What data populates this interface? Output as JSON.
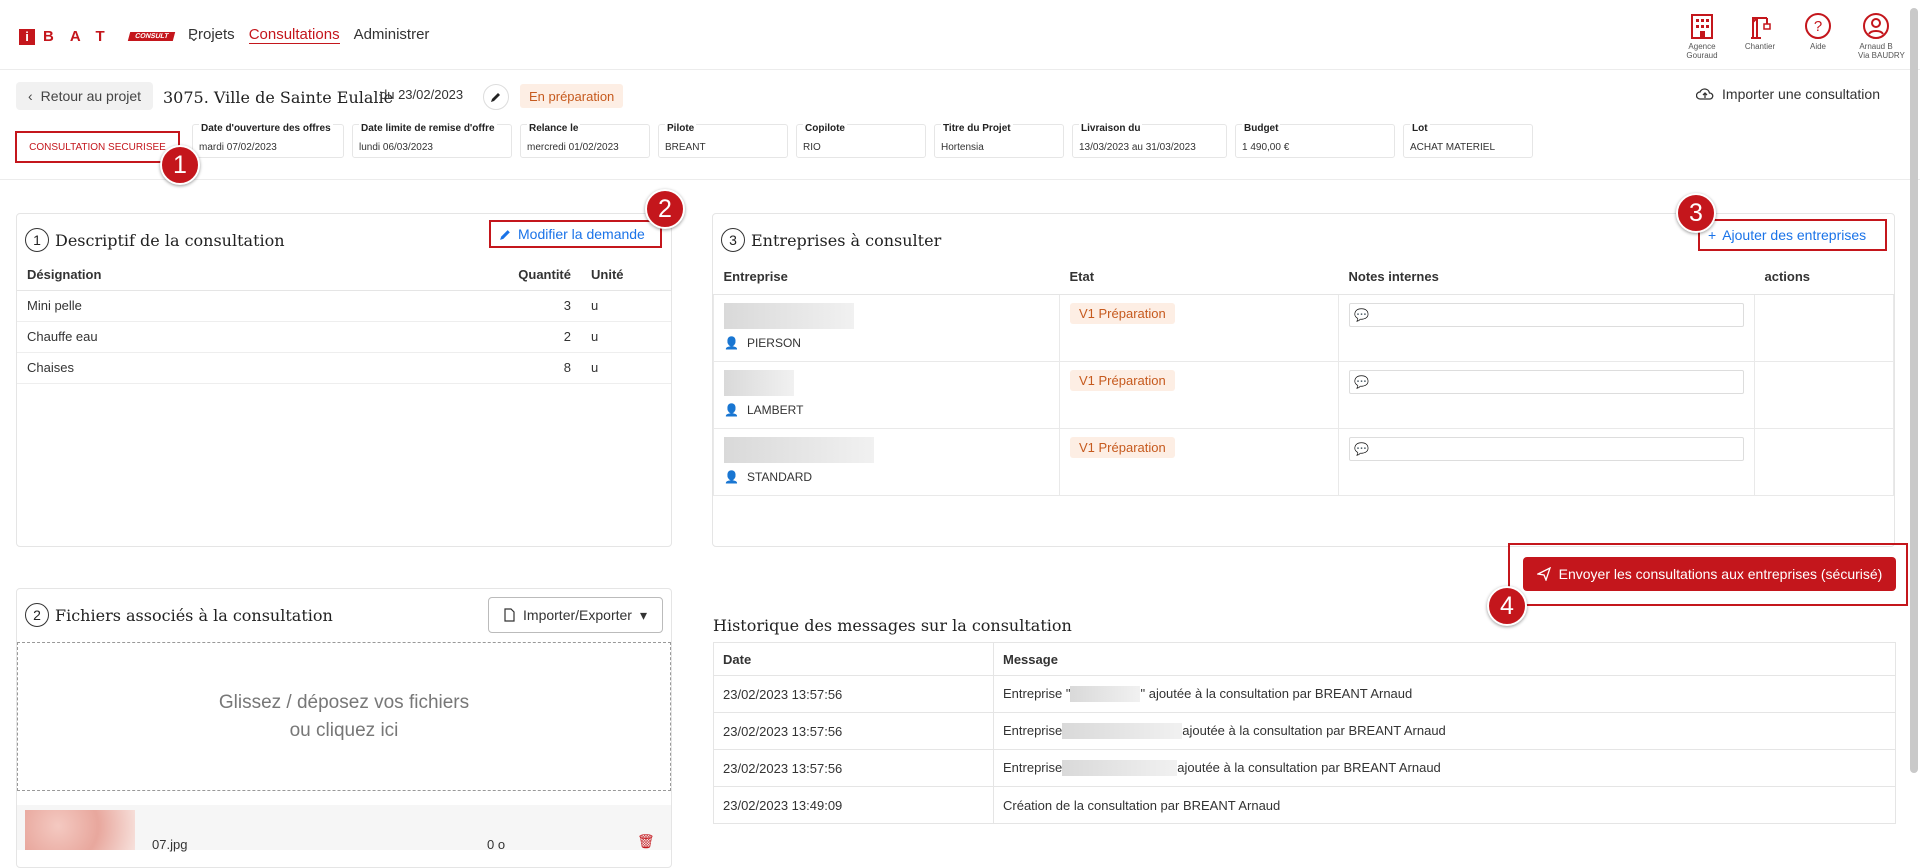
{
  "nav": {
    "brand_letters": "BAT",
    "brand_tag": "CONSULT",
    "links": [
      {
        "label": "Projets"
      },
      {
        "label": "Consultations"
      },
      {
        "label": "Administrer"
      }
    ],
    "icons": [
      {
        "name": "building-icon",
        "label": "Agence\nGouraud"
      },
      {
        "name": "crane-icon",
        "label": "Chantier"
      },
      {
        "name": "help-icon",
        "label": "Aide"
      },
      {
        "name": "user-icon",
        "label": "Arnaud B\nVia BAUDRY"
      }
    ],
    "accent": "#c4161c"
  },
  "header": {
    "back_label": "Retour au projet",
    "title": "3075. Ville de Sainte Eulalie",
    "date": "du 23/02/2023",
    "status": "En préparation",
    "import_label": "Importer une consultation"
  },
  "badge": "CONSULTATION SECURISEE",
  "info": [
    {
      "label": "Date d'ouverture des offres",
      "value": "mardi 07/02/2023"
    },
    {
      "label": "Date limite de remise d'offre",
      "value": "lundi 06/03/2023"
    },
    {
      "label": "Relance le",
      "value": "mercredi 01/02/2023"
    },
    {
      "label": "Pilote",
      "value": "BREANT"
    },
    {
      "label": "Copilote",
      "value": "RIO"
    },
    {
      "label": "Titre du Projet",
      "value": "Hortensia"
    },
    {
      "label": "Livraison du",
      "value": "13/03/2023 au 31/03/2023"
    },
    {
      "label": "Budget",
      "value": "1 490,00 €"
    },
    {
      "label": "Lot",
      "value": "ACHAT MATERIEL"
    }
  ],
  "markers": [
    "1",
    "2",
    "3",
    "4"
  ],
  "desc": {
    "num": "1",
    "title": "Descriptif de la consultation",
    "edit_label": "Modifier la demande",
    "headers": [
      "Désignation",
      "Quantité",
      "Unité"
    ],
    "rows": [
      [
        "Mini pelle",
        "3",
        "u"
      ],
      [
        "Chauffe eau",
        "2",
        "u"
      ],
      [
        "Chaises",
        "8",
        "u"
      ]
    ]
  },
  "entreprises": {
    "num": "3",
    "title": "Entreprises à consulter",
    "add_label": "Ajouter des entreprises",
    "headers": [
      "Entreprise",
      "Etat",
      "Notes internes",
      "actions"
    ],
    "rows": [
      {
        "contact": "PIERSON",
        "state": "V1 Préparation"
      },
      {
        "contact": "LAMBERT",
        "state": "V1 Préparation"
      },
      {
        "contact": "STANDARD",
        "state": "V1 Préparation"
      }
    ]
  },
  "send_label": "Envoyer les consultations aux entreprises (sécurisé)",
  "files": {
    "num": "2",
    "title": "Fichiers associés à la consultation",
    "io_label": "Importer/Exporter",
    "drop_line1": "Glissez / déposez vos fichiers",
    "drop_line2": "ou cliquez ici",
    "file_name": "07.jpg",
    "file_size": "0 o"
  },
  "history": {
    "title": "Historique des messages sur la consultation",
    "headers": [
      "Date",
      "Message"
    ],
    "rows": [
      {
        "date": "23/02/2023 13:57:56",
        "prefix": "Entreprise \"",
        "suffix": "\" ajoutée à la consultation par BREANT Arnaud"
      },
      {
        "date": "23/02/2023 13:57:56",
        "prefix": "Entreprise",
        "suffix": "ajoutée à la consultation par BREANT Arnaud"
      },
      {
        "date": "23/02/2023 13:57:56",
        "prefix": "Entreprise",
        "suffix": "ajoutée à la consultation par BREANT Arnaud"
      },
      {
        "date": "23/02/2023 13:49:09",
        "prefix": "Création de la consultation par BREANT Arnaud",
        "suffix": ""
      }
    ]
  }
}
